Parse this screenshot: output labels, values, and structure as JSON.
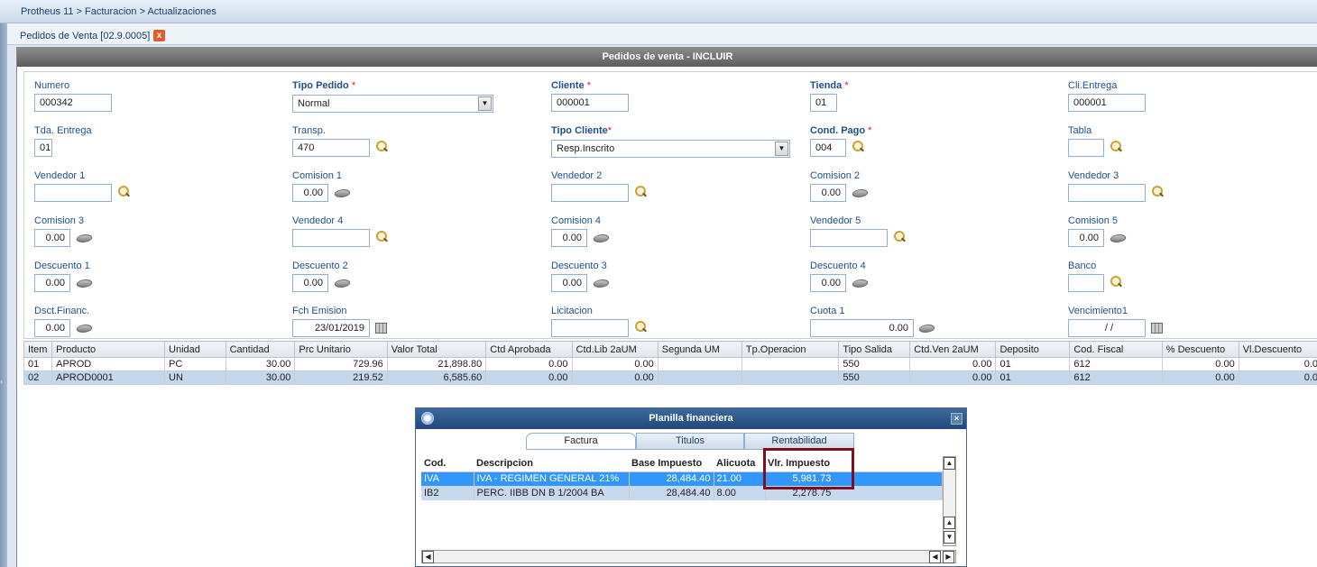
{
  "breadcrumb": "Protheus 11 > Facturacion > Actualizaciones",
  "tab": {
    "label": "Pedidos de Venta [02.9.0005]",
    "close": "x"
  },
  "panel_title": "Pedidos de venta - INCLUIR",
  "form": {
    "numero": {
      "label": "Numero",
      "value": "000342"
    },
    "tipo_pedido": {
      "label": "Tipo Pedido",
      "value": "Normal"
    },
    "cliente": {
      "label": "Cliente",
      "value": "000001"
    },
    "tienda": {
      "label": "Tienda",
      "value": "01"
    },
    "cli_entrega": {
      "label": "Cli.Entrega",
      "value": "000001"
    },
    "tda_entrega": {
      "label": "Tda. Entrega",
      "value": "01"
    },
    "transp": {
      "label": "Transp.",
      "value": "470"
    },
    "tipo_cliente": {
      "label": "Tipo Cliente",
      "value": "Resp.Inscrito"
    },
    "cond_pago": {
      "label": "Cond. Pago",
      "value": "004"
    },
    "tabla": {
      "label": "Tabla",
      "value": ""
    },
    "vendedor1": {
      "label": "Vendedor 1",
      "value": ""
    },
    "comision1": {
      "label": "Comision 1",
      "value": "0.00"
    },
    "vendedor2": {
      "label": "Vendedor 2",
      "value": ""
    },
    "comision2": {
      "label": "Comision 2",
      "value": "0.00"
    },
    "vendedor3": {
      "label": "Vendedor 3",
      "value": ""
    },
    "comision3": {
      "label": "Comision 3",
      "value": "0.00"
    },
    "vendedor4": {
      "label": "Vendedor 4",
      "value": ""
    },
    "comision4": {
      "label": "Comision 4",
      "value": "0.00"
    },
    "vendedor5": {
      "label": "Vendedor 5",
      "value": ""
    },
    "comision5": {
      "label": "Comision 5",
      "value": "0.00"
    },
    "descuento1": {
      "label": "Descuento 1",
      "value": "0.00"
    },
    "descuento2": {
      "label": "Descuento 2",
      "value": "0.00"
    },
    "descuento3": {
      "label": "Descuento 3",
      "value": "0.00"
    },
    "descuento4": {
      "label": "Descuento 4",
      "value": "0.00"
    },
    "banco": {
      "label": "Banco",
      "value": ""
    },
    "dsct_financ": {
      "label": "Dsct.Financ.",
      "value": "0.00"
    },
    "fch_emision": {
      "label": "Fch Emision",
      "value": "23/01/2019"
    },
    "licitacion": {
      "label": "Licitacion",
      "value": ""
    },
    "cuota1": {
      "label": "Cuota 1",
      "value": "0.00"
    },
    "vencimiento1": {
      "label": "Vencimiento1",
      "value": "/ /"
    }
  },
  "grid": {
    "headers": [
      "Item",
      "Producto",
      "Unidad",
      "Cantidad",
      "Prc Unitario",
      "Valor Total",
      "Ctd Aprobada",
      "Ctd.Lib 2aUM",
      "Segunda UM",
      "Tp.Operacion",
      "Tipo Salida",
      "Ctd.Ven 2aUM",
      "Deposito",
      "Cod. Fiscal",
      "% Descuento",
      "Vl.Descuento"
    ],
    "rows": [
      [
        "01",
        "APROD",
        "PC",
        "30.00",
        "729.96",
        "21,898.80",
        "0.00",
        "0.00",
        "",
        "",
        "550",
        "0.00",
        "01",
        "612",
        "0.00",
        "0.0"
      ],
      [
        "02",
        "APROD0001",
        "UN",
        "30.00",
        "219.52",
        "6,585.60",
        "0.00",
        "0.00",
        "",
        "",
        "550",
        "0.00",
        "01",
        "612",
        "0.00",
        "0.0"
      ]
    ]
  },
  "dialog": {
    "title": "Planilla financiera",
    "tabs": [
      "Factura",
      "Titulos",
      "Rentabilidad"
    ],
    "headers": [
      "Cod.",
      "Descripcion",
      "Base Impuesto",
      "Alicuota",
      "Vlr. Impuesto"
    ],
    "rows": [
      [
        "IVA",
        "IVA - REGIMEN GENERAL 21%",
        "28,484.40",
        "21.00",
        "5,981.73"
      ],
      [
        "IB2",
        "PERC. IIBB DN B 1/2004  BA",
        "28,484.40",
        "8.00",
        "2,278.75"
      ]
    ]
  },
  "colors": {
    "highlight_border": "#7a1020",
    "selected_row": "#3297fd",
    "title_bar": "#5c5c5c"
  }
}
